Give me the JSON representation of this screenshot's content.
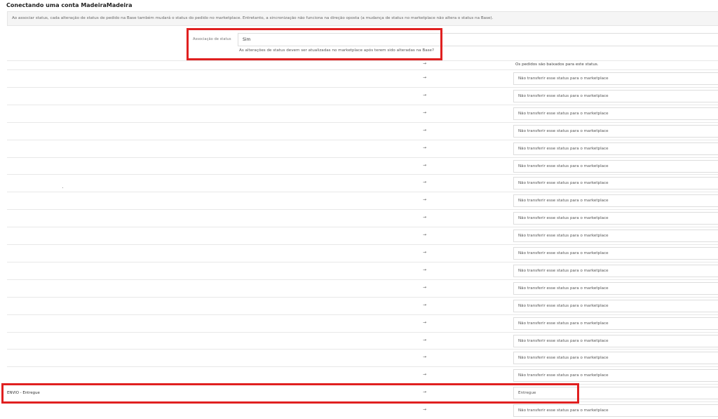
{
  "page": {
    "title": "Conectando uma conta MadeiraMadeira",
    "notice": "Ao associar status, cada alteração de status de pedido na Base também mudará o status do pedido no marketplace. Entretanto, a sincronização não funciona na direção oposta (a mudança de status no marketplace não altera o status na Base)."
  },
  "association": {
    "label": "Associação de status",
    "value": "Sim",
    "help": "As alterações de status devem ser atualizadas no marketplace após terem sido alteradas na Base?"
  },
  "header_row": {
    "arrow": "→",
    "note": "Os pedidos são baixados para este status."
  },
  "arrow_glyph": "→",
  "rows": [
    {
      "left": "",
      "value": "Não transferir esse status para o marketplace"
    },
    {
      "left": "",
      "value": "Não transferir esse status para o marketplace"
    },
    {
      "left": "",
      "value": "Não transferir esse status para o marketplace"
    },
    {
      "left": "",
      "value": "Não transferir esse status para o marketplace"
    },
    {
      "left": "",
      "value": "Não transferir esse status para o marketplace"
    },
    {
      "left": "",
      "value": "Não transferir esse status para o marketplace"
    },
    {
      "left": "",
      "value": "Não transferir esse status para o marketplace"
    },
    {
      "left": "",
      "value": "Não transferir esse status para o marketplace"
    },
    {
      "left": "",
      "value": "Não transferir esse status para o marketplace"
    },
    {
      "left": "",
      "value": "Não transferir esse status para o marketplace"
    },
    {
      "left": "",
      "value": "Não transferir esse status para o marketplace"
    },
    {
      "left": "",
      "value": "Não transferir esse status para o marketplace"
    },
    {
      "left": "",
      "value": "Não transferir esse status para o marketplace"
    },
    {
      "left": "",
      "value": "Não transferir esse status para o marketplace"
    },
    {
      "left": "",
      "value": "Não transferir esse status para o marketplace"
    },
    {
      "left": "",
      "value": "Não transferir esse status para o marketplace"
    },
    {
      "left": "",
      "value": "Não transferir esse status para o marketplace"
    },
    {
      "left": "",
      "value": "Não transferir esse status para o marketplace"
    },
    {
      "left": "ENVIO - Entregue",
      "value": "Entregue"
    },
    {
      "left": "",
      "value": "Não transferir esse status para o marketplace"
    }
  ],
  "colors": {
    "highlight": "#e02020"
  }
}
